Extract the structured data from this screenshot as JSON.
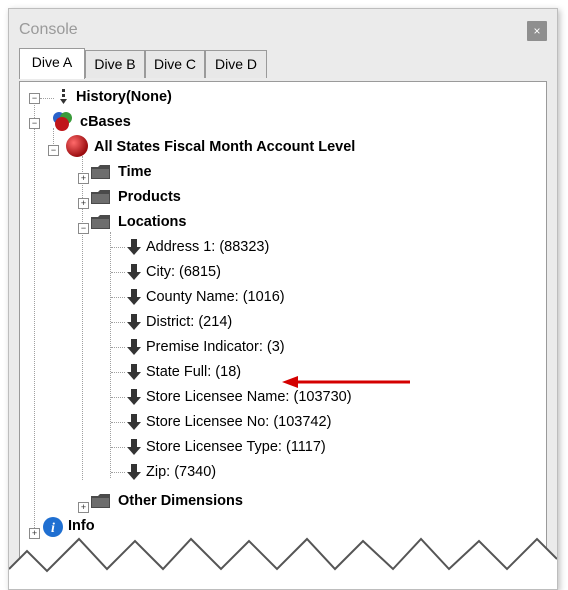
{
  "window": {
    "title": "Console",
    "close_label": "×"
  },
  "tabs": [
    {
      "label": "Dive A",
      "active": true
    },
    {
      "label": "Dive B",
      "active": false
    },
    {
      "label": "Dive C",
      "active": false
    },
    {
      "label": "Dive D",
      "active": false
    }
  ],
  "tree": {
    "history": "History(None)",
    "cbases": "cBases",
    "cbase_name": "All States Fiscal Month Account Level",
    "dimensions": {
      "time": "Time",
      "products": "Products",
      "locations": "Locations",
      "other": "Other Dimensions"
    },
    "location_items": [
      "Address 1: (88323)",
      "City: (6815)",
      "County Name: (1016)",
      "District: (214)",
      "Premise Indicator: (3)",
      "State Full: (18)",
      "Store Licensee Name: (103730)",
      "Store Licensee No: (103742)",
      "Store Licensee Type: (1117)",
      "Zip: (7340)"
    ],
    "info": "Info"
  },
  "colors": {
    "annotation_arrow": "#d40000",
    "info_icon": "#1f6fd1",
    "cbase_sphere": "#c0161a"
  },
  "icons": [
    "collapse-icon",
    "expand-icon",
    "history-icon",
    "cbases-icon",
    "cube-sphere-icon",
    "folder-icon",
    "down-arrow-icon",
    "info-icon",
    "annotation-arrow"
  ]
}
